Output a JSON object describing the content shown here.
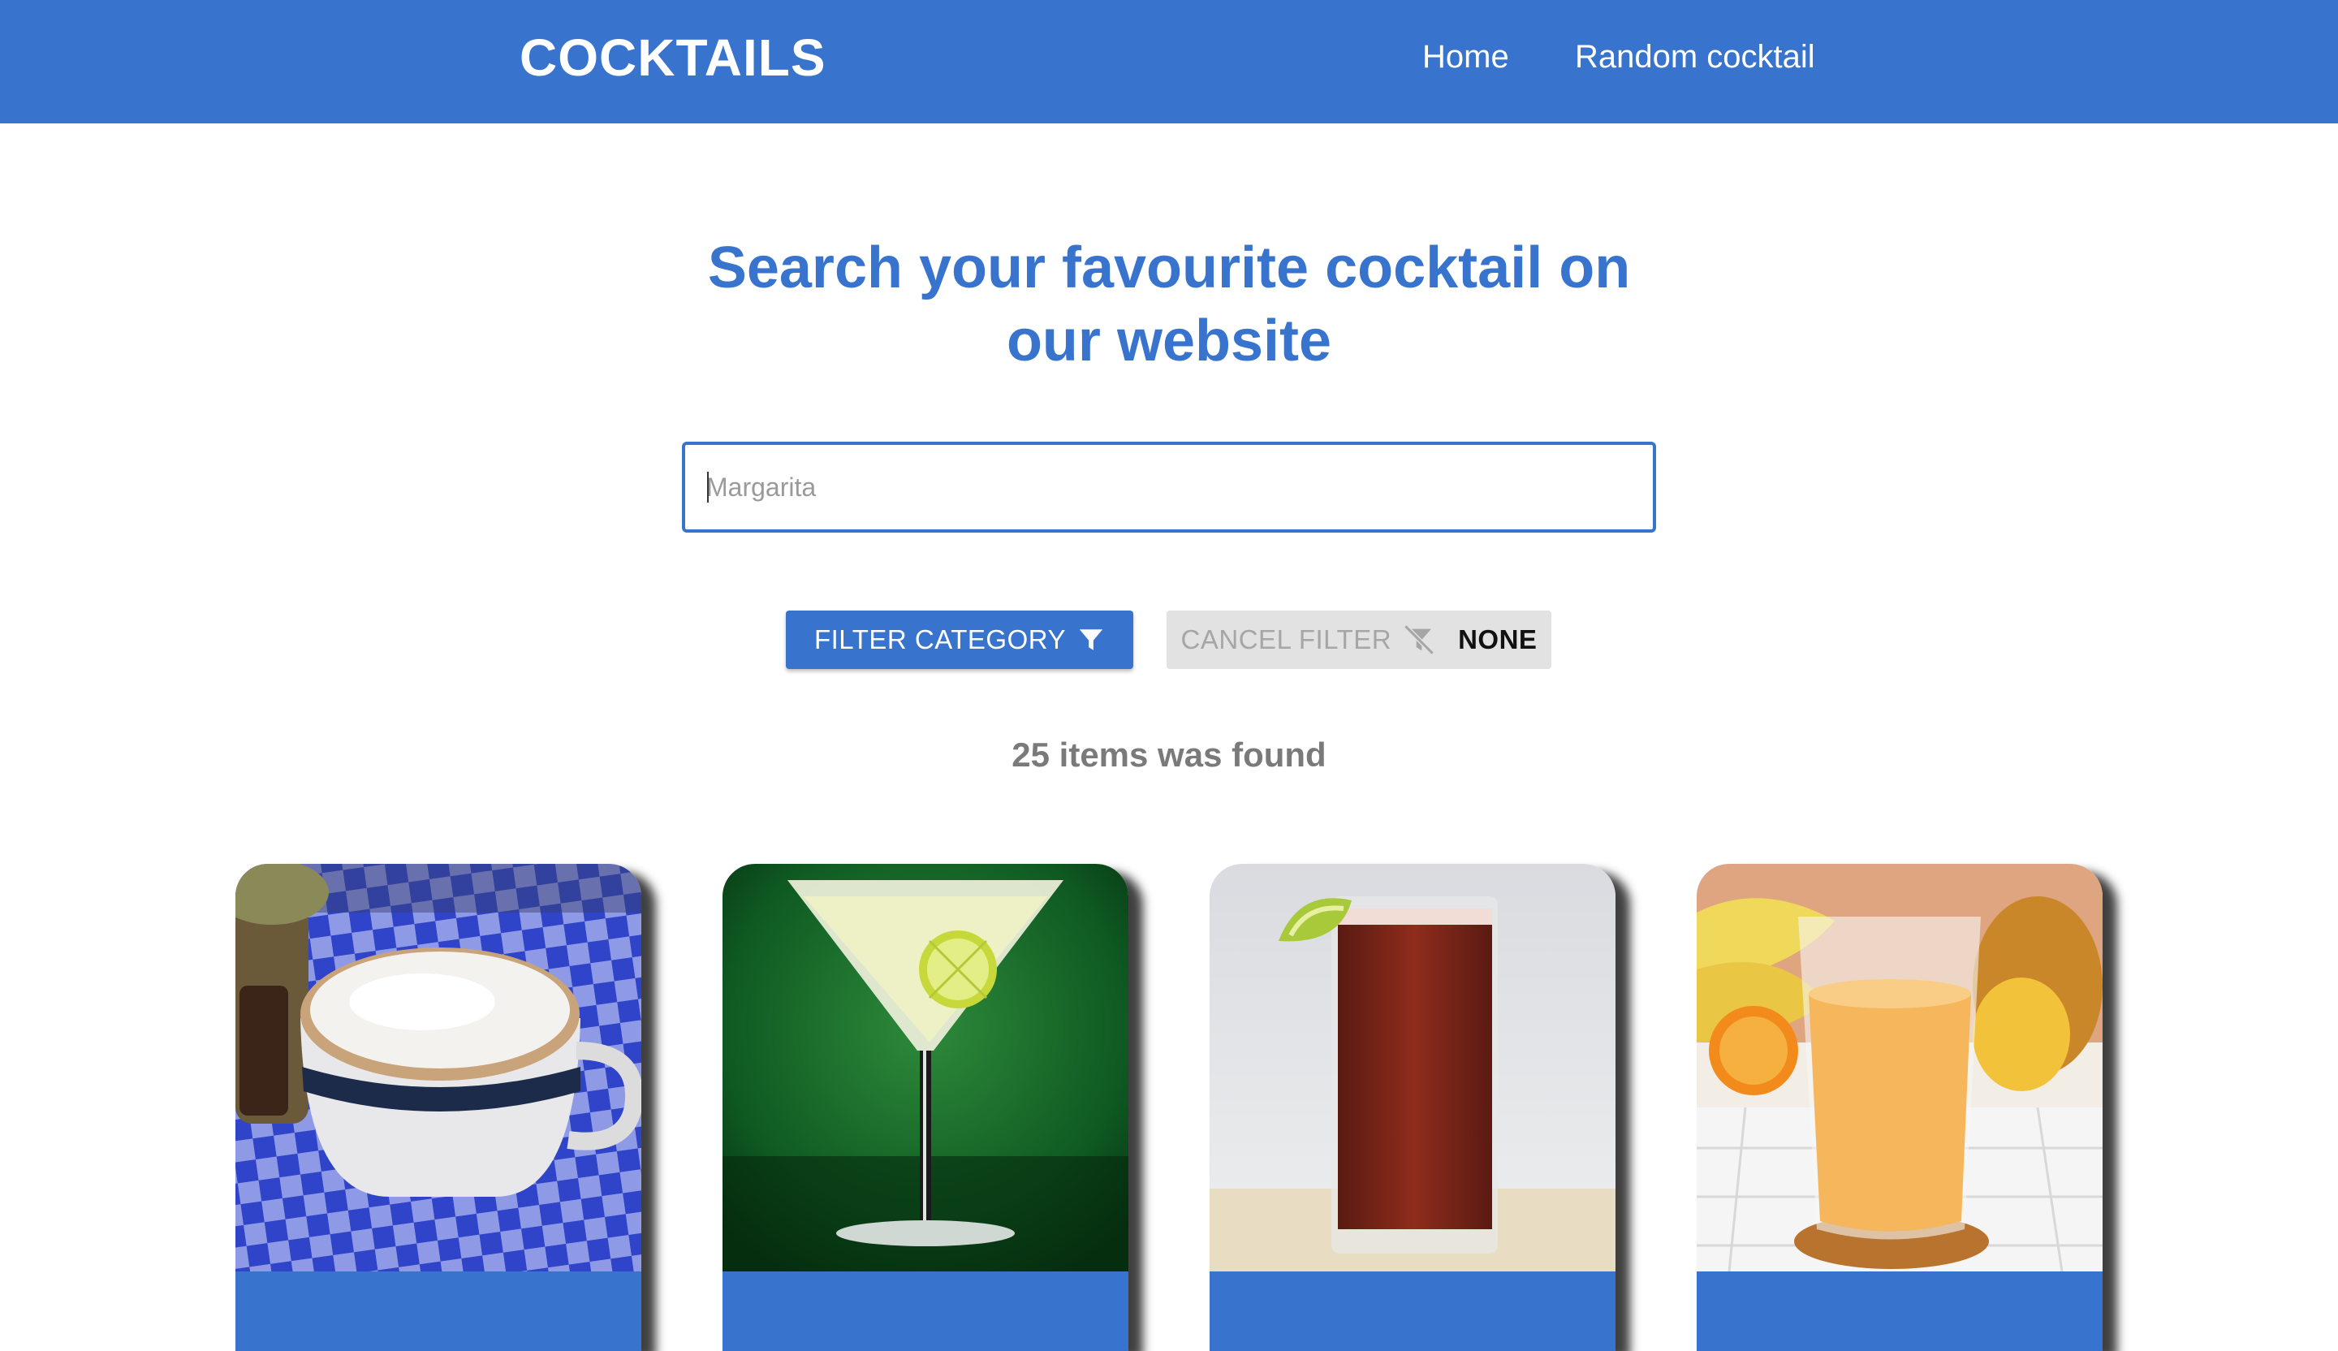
{
  "header": {
    "brand": "COCKTAILS",
    "nav": {
      "home": "Home",
      "random": "Random cocktail"
    }
  },
  "main": {
    "headline_line1": "Search your favourite cocktail on",
    "headline_line2": "our website",
    "search": {
      "placeholder": "Margarita",
      "value": ""
    },
    "filter_button": {
      "label": "FILTER CATEGORY",
      "icon": "filter-icon"
    },
    "cancel_filter_button": {
      "label": "CANCEL FILTER",
      "icon": "filter-off-icon",
      "current_category": "NONE"
    },
    "results_text": "25 items was found"
  },
  "cards": [
    {
      "image": "cappuccino-in-mug-on-blue-checkered-cloth"
    },
    {
      "image": "martini-glass-with-lime-on-green-background"
    },
    {
      "image": "red-drink-in-tall-glass-with-lime"
    },
    {
      "image": "orange-juice-glass-with-fruits"
    }
  ],
  "colors": {
    "primary": "#3874cd",
    "secondary_button": "#e2e2e2",
    "results_text": "#7a7a7a"
  }
}
